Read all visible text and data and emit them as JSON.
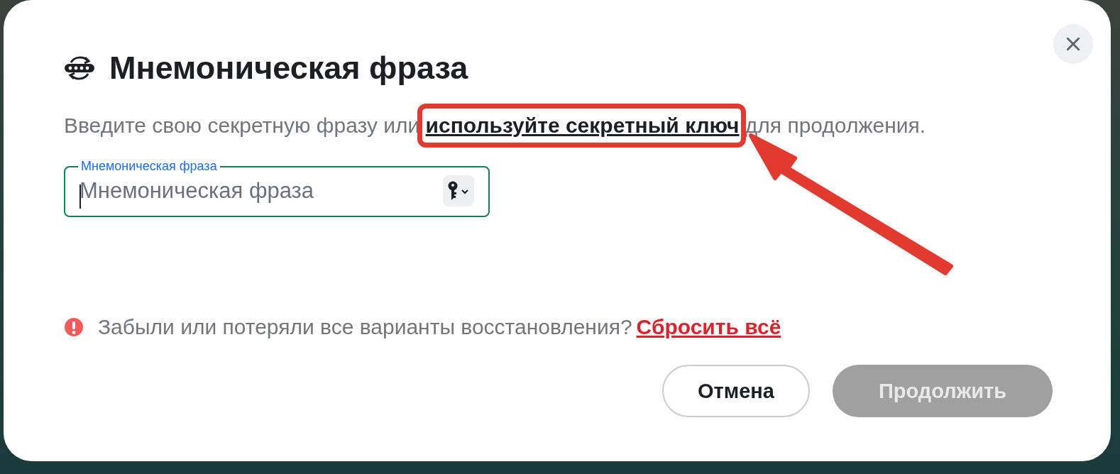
{
  "dialog": {
    "title": "Мнемоническая фраза",
    "description": {
      "before": "Введите свою секретную фразу или ",
      "link": "используйте секретный ключ",
      "after": " для продолжения.",
      "link_highlighted": true
    },
    "field": {
      "label": "Мнемоническая фраза",
      "placeholder": "Мнемоническая фраза",
      "focused": true
    },
    "warning": {
      "text": "Забыли или потеряли все варианты восстановления?",
      "link": "Сбросить всё"
    },
    "buttons": [
      {
        "label": "Отмена",
        "kind": "secondary",
        "disabled": false
      },
      {
        "label": "Продолжить",
        "kind": "primary",
        "disabled": true
      }
    ]
  }
}
